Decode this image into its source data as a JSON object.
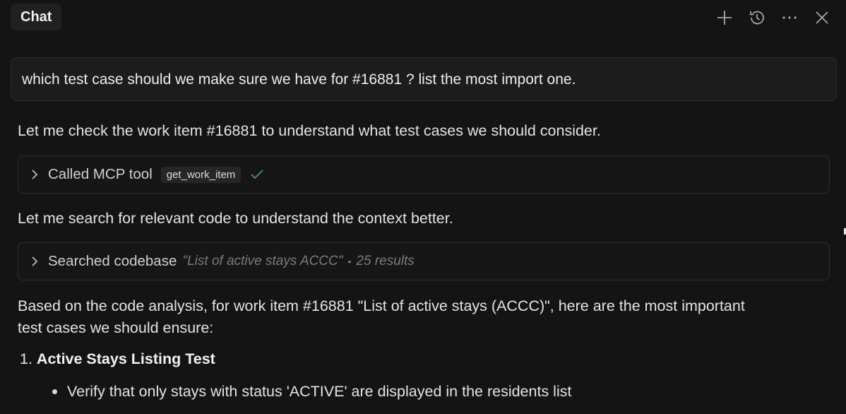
{
  "header": {
    "tab_label": "Chat",
    "icons": [
      "plus-icon",
      "history-icon",
      "more-icon",
      "close-icon"
    ]
  },
  "user_message": "which test case should we make sure we have for #16881 ? list the most import one.",
  "assistant": {
    "intro": "Let me check the work item #16881 to understand what test cases we should consider.",
    "tool_call": {
      "label": "Called MCP tool",
      "tool_name": "get_work_item",
      "status": "success"
    },
    "search_intro": "Let me search for relevant code to understand the context better.",
    "search_call": {
      "label": "Searched codebase",
      "query": "\"List of active stays ACCC\"",
      "separator": "•",
      "results": "25 results"
    },
    "analysis_line1": "Based on the code analysis, for work item #16881 \"List of active stays (ACCC)\", here are the most important",
    "analysis_line2": "test cases we should ensure:",
    "list": {
      "number": "1.",
      "title": "Active Stays Listing Test",
      "bullets": [
        "Verify that only stays with status 'ACTIVE' are displayed in the residents list"
      ]
    }
  },
  "colors": {
    "background": "#141414",
    "success": "#4a9a5a",
    "muted": "#7c7c7c"
  }
}
